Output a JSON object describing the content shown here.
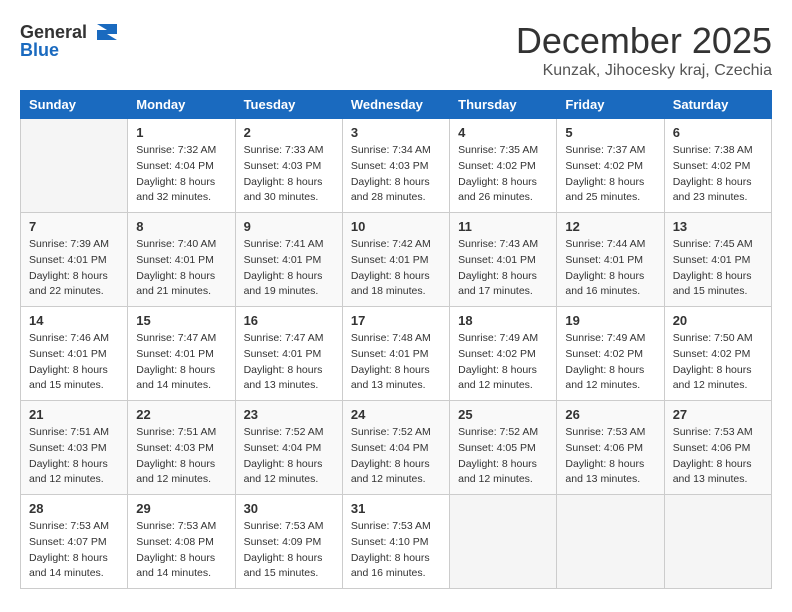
{
  "header": {
    "logo_general": "General",
    "logo_blue": "Blue",
    "month_title": "December 2025",
    "subtitle": "Kunzak, Jihocesky kraj, Czechia"
  },
  "weekdays": [
    "Sunday",
    "Monday",
    "Tuesday",
    "Wednesday",
    "Thursday",
    "Friday",
    "Saturday"
  ],
  "weeks": [
    [
      {
        "day": "",
        "sunrise": "",
        "sunset": "",
        "daylight": ""
      },
      {
        "day": "1",
        "sunrise": "Sunrise: 7:32 AM",
        "sunset": "Sunset: 4:04 PM",
        "daylight": "Daylight: 8 hours and 32 minutes."
      },
      {
        "day": "2",
        "sunrise": "Sunrise: 7:33 AM",
        "sunset": "Sunset: 4:03 PM",
        "daylight": "Daylight: 8 hours and 30 minutes."
      },
      {
        "day": "3",
        "sunrise": "Sunrise: 7:34 AM",
        "sunset": "Sunset: 4:03 PM",
        "daylight": "Daylight: 8 hours and 28 minutes."
      },
      {
        "day": "4",
        "sunrise": "Sunrise: 7:35 AM",
        "sunset": "Sunset: 4:02 PM",
        "daylight": "Daylight: 8 hours and 26 minutes."
      },
      {
        "day": "5",
        "sunrise": "Sunrise: 7:37 AM",
        "sunset": "Sunset: 4:02 PM",
        "daylight": "Daylight: 8 hours and 25 minutes."
      },
      {
        "day": "6",
        "sunrise": "Sunrise: 7:38 AM",
        "sunset": "Sunset: 4:02 PM",
        "daylight": "Daylight: 8 hours and 23 minutes."
      }
    ],
    [
      {
        "day": "7",
        "sunrise": "Sunrise: 7:39 AM",
        "sunset": "Sunset: 4:01 PM",
        "daylight": "Daylight: 8 hours and 22 minutes."
      },
      {
        "day": "8",
        "sunrise": "Sunrise: 7:40 AM",
        "sunset": "Sunset: 4:01 PM",
        "daylight": "Daylight: 8 hours and 21 minutes."
      },
      {
        "day": "9",
        "sunrise": "Sunrise: 7:41 AM",
        "sunset": "Sunset: 4:01 PM",
        "daylight": "Daylight: 8 hours and 19 minutes."
      },
      {
        "day": "10",
        "sunrise": "Sunrise: 7:42 AM",
        "sunset": "Sunset: 4:01 PM",
        "daylight": "Daylight: 8 hours and 18 minutes."
      },
      {
        "day": "11",
        "sunrise": "Sunrise: 7:43 AM",
        "sunset": "Sunset: 4:01 PM",
        "daylight": "Daylight: 8 hours and 17 minutes."
      },
      {
        "day": "12",
        "sunrise": "Sunrise: 7:44 AM",
        "sunset": "Sunset: 4:01 PM",
        "daylight": "Daylight: 8 hours and 16 minutes."
      },
      {
        "day": "13",
        "sunrise": "Sunrise: 7:45 AM",
        "sunset": "Sunset: 4:01 PM",
        "daylight": "Daylight: 8 hours and 15 minutes."
      }
    ],
    [
      {
        "day": "14",
        "sunrise": "Sunrise: 7:46 AM",
        "sunset": "Sunset: 4:01 PM",
        "daylight": "Daylight: 8 hours and 15 minutes."
      },
      {
        "day": "15",
        "sunrise": "Sunrise: 7:47 AM",
        "sunset": "Sunset: 4:01 PM",
        "daylight": "Daylight: 8 hours and 14 minutes."
      },
      {
        "day": "16",
        "sunrise": "Sunrise: 7:47 AM",
        "sunset": "Sunset: 4:01 PM",
        "daylight": "Daylight: 8 hours and 13 minutes."
      },
      {
        "day": "17",
        "sunrise": "Sunrise: 7:48 AM",
        "sunset": "Sunset: 4:01 PM",
        "daylight": "Daylight: 8 hours and 13 minutes."
      },
      {
        "day": "18",
        "sunrise": "Sunrise: 7:49 AM",
        "sunset": "Sunset: 4:02 PM",
        "daylight": "Daylight: 8 hours and 12 minutes."
      },
      {
        "day": "19",
        "sunrise": "Sunrise: 7:49 AM",
        "sunset": "Sunset: 4:02 PM",
        "daylight": "Daylight: 8 hours and 12 minutes."
      },
      {
        "day": "20",
        "sunrise": "Sunrise: 7:50 AM",
        "sunset": "Sunset: 4:02 PM",
        "daylight": "Daylight: 8 hours and 12 minutes."
      }
    ],
    [
      {
        "day": "21",
        "sunrise": "Sunrise: 7:51 AM",
        "sunset": "Sunset: 4:03 PM",
        "daylight": "Daylight: 8 hours and 12 minutes."
      },
      {
        "day": "22",
        "sunrise": "Sunrise: 7:51 AM",
        "sunset": "Sunset: 4:03 PM",
        "daylight": "Daylight: 8 hours and 12 minutes."
      },
      {
        "day": "23",
        "sunrise": "Sunrise: 7:52 AM",
        "sunset": "Sunset: 4:04 PM",
        "daylight": "Daylight: 8 hours and 12 minutes."
      },
      {
        "day": "24",
        "sunrise": "Sunrise: 7:52 AM",
        "sunset": "Sunset: 4:04 PM",
        "daylight": "Daylight: 8 hours and 12 minutes."
      },
      {
        "day": "25",
        "sunrise": "Sunrise: 7:52 AM",
        "sunset": "Sunset: 4:05 PM",
        "daylight": "Daylight: 8 hours and 12 minutes."
      },
      {
        "day": "26",
        "sunrise": "Sunrise: 7:53 AM",
        "sunset": "Sunset: 4:06 PM",
        "daylight": "Daylight: 8 hours and 13 minutes."
      },
      {
        "day": "27",
        "sunrise": "Sunrise: 7:53 AM",
        "sunset": "Sunset: 4:06 PM",
        "daylight": "Daylight: 8 hours and 13 minutes."
      }
    ],
    [
      {
        "day": "28",
        "sunrise": "Sunrise: 7:53 AM",
        "sunset": "Sunset: 4:07 PM",
        "daylight": "Daylight: 8 hours and 14 minutes."
      },
      {
        "day": "29",
        "sunrise": "Sunrise: 7:53 AM",
        "sunset": "Sunset: 4:08 PM",
        "daylight": "Daylight: 8 hours and 14 minutes."
      },
      {
        "day": "30",
        "sunrise": "Sunrise: 7:53 AM",
        "sunset": "Sunset: 4:09 PM",
        "daylight": "Daylight: 8 hours and 15 minutes."
      },
      {
        "day": "31",
        "sunrise": "Sunrise: 7:53 AM",
        "sunset": "Sunset: 4:10 PM",
        "daylight": "Daylight: 8 hours and 16 minutes."
      },
      {
        "day": "",
        "sunrise": "",
        "sunset": "",
        "daylight": ""
      },
      {
        "day": "",
        "sunrise": "",
        "sunset": "",
        "daylight": ""
      },
      {
        "day": "",
        "sunrise": "",
        "sunset": "",
        "daylight": ""
      }
    ]
  ]
}
